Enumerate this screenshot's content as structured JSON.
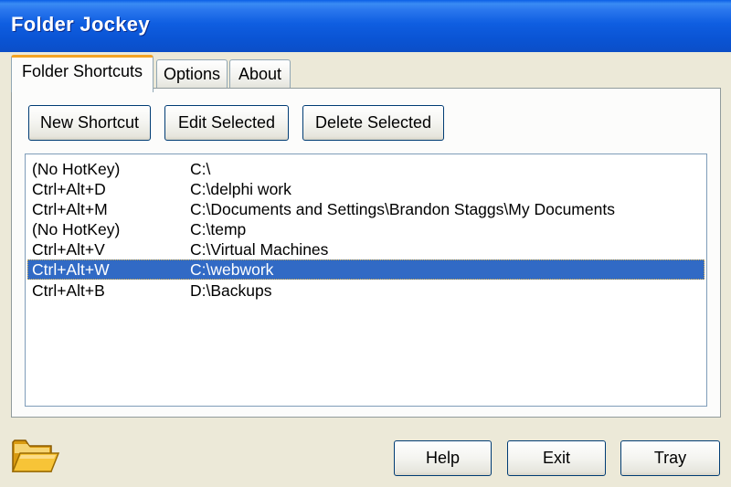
{
  "window": {
    "title": "Folder Jockey"
  },
  "tabs": [
    {
      "label": "Folder Shortcuts",
      "active": true
    },
    {
      "label": "Options",
      "active": false
    },
    {
      "label": "About",
      "active": false
    }
  ],
  "toolbar": {
    "new_label": "New Shortcut",
    "edit_label": "Edit Selected",
    "delete_label": "Delete Selected"
  },
  "shortcuts": [
    {
      "hotkey": "(No HotKey)",
      "path": "C:\\"
    },
    {
      "hotkey": "Ctrl+Alt+D",
      "path": "C:\\delphi work"
    },
    {
      "hotkey": "Ctrl+Alt+M",
      "path": "C:\\Documents and Settings\\Brandon Staggs\\My Documents"
    },
    {
      "hotkey": "(No HotKey)",
      "path": "C:\\temp"
    },
    {
      "hotkey": "Ctrl+Alt+V",
      "path": "C:\\Virtual Machines"
    },
    {
      "hotkey": "Ctrl+Alt+W",
      "path": "C:\\webwork",
      "selected": true
    },
    {
      "hotkey": "Ctrl+Alt+B",
      "path": "D:\\Backups"
    }
  ],
  "footer": {
    "help_label": "Help",
    "exit_label": "Exit",
    "tray_label": "Tray",
    "app_icon": "folder-icon"
  },
  "colors": {
    "selection": "#316ac5",
    "titlebar": "#0a54d4",
    "active_tab_accent": "#f3a323"
  }
}
